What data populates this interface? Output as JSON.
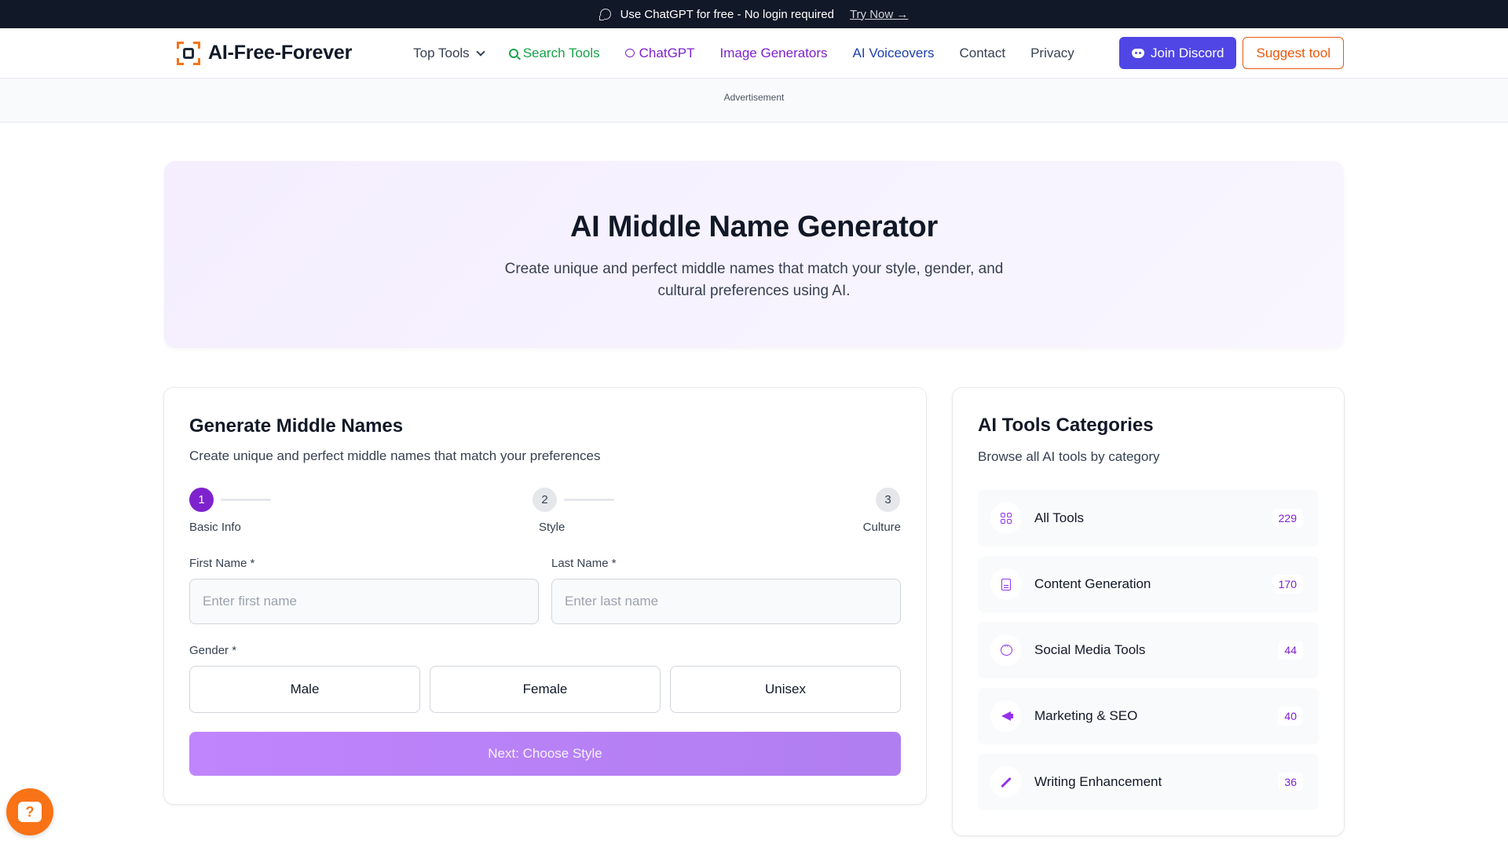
{
  "promo": {
    "text": "Use ChatGPT for free - No login required",
    "link": "Try Now →"
  },
  "brand": {
    "name": "AI-Free-Forever"
  },
  "nav": {
    "top_tools": "Top Tools",
    "search_tools": "Search Tools",
    "chatgpt": "ChatGPT",
    "image_generators": "Image Generators",
    "ai_voiceovers": "AI Voiceovers",
    "contact": "Contact",
    "privacy": "Privacy",
    "join_discord": "Join Discord",
    "suggest_tool": "Suggest tool"
  },
  "ad": {
    "label": "Advertisement"
  },
  "hero": {
    "title": "AI Middle Name Generator",
    "subtitle": "Create unique and perfect middle names that match your style, gender, and cultural preferences using AI."
  },
  "form": {
    "title": "Generate Middle Names",
    "subtitle": "Create unique and perfect middle names that match your preferences",
    "steps": [
      {
        "num": "1",
        "label": "Basic Info"
      },
      {
        "num": "2",
        "label": "Style"
      },
      {
        "num": "3",
        "label": "Culture"
      }
    ],
    "first_name_label": "First Name *",
    "first_name_placeholder": "Enter first name",
    "last_name_label": "Last Name *",
    "last_name_placeholder": "Enter last name",
    "gender_label": "Gender *",
    "genders": [
      "Male",
      "Female",
      "Unisex"
    ],
    "next_label": "Next: Choose Style"
  },
  "categories": {
    "title": "AI Tools Categories",
    "subtitle": "Browse all AI tools by category",
    "items": [
      {
        "icon": "grid-icon",
        "name": "All Tools",
        "count": "229"
      },
      {
        "icon": "document-icon",
        "name": "Content Generation",
        "count": "170"
      },
      {
        "icon": "message-icon",
        "name": "Social Media Tools",
        "count": "44"
      },
      {
        "icon": "megaphone-icon",
        "name": "Marketing & SEO",
        "count": "40"
      },
      {
        "icon": "pen-icon",
        "name": "Writing Enhancement",
        "count": "36"
      }
    ]
  },
  "colors": {
    "accent": "#7e22ce",
    "brand": "#f97316",
    "discord": "#4f46e5"
  }
}
